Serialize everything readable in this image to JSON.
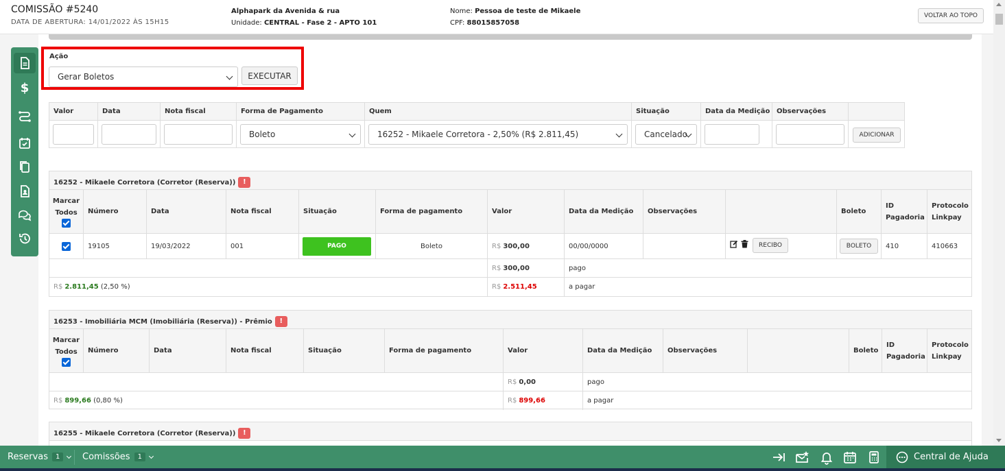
{
  "header": {
    "title": "COMISSÃO #5240",
    "opened": "DATA DE ABERTURA: 14/01/2022 ÀS 15H15",
    "project": "Alphapark da Avenida & rua",
    "unit_label": "Unidade:",
    "unit_value": "CENTRAL - Fase 2 - APTO 101",
    "name_label": "Nome:",
    "name_value": "Pessoa de teste de Mikaele",
    "cpf_label": "CPF:",
    "cpf_value": "88015857058",
    "back_to_top": "VOLTAR AO TOPO"
  },
  "sidebar": {
    "icons": [
      "document-icon",
      "dollar-icon",
      "route-icon",
      "calendar-check-icon",
      "copy-icon",
      "contact-icon",
      "chat-icon",
      "history-icon"
    ]
  },
  "action": {
    "label": "Ação",
    "selected": "Gerar Boletos",
    "execute": "EXECUTAR"
  },
  "form": {
    "headers": [
      "Valor",
      "Data",
      "Nota fiscal",
      "Forma de Pagamento",
      "Quem",
      "Situação",
      "Data da Medição",
      "Observações"
    ],
    "forma_selected": "Boleto",
    "quem_selected": "16252 - Mikaele Corretora - 2,50% (R$ 2.811,45)",
    "situacao_selected": "Cancelado",
    "add": "ADICIONAR"
  },
  "table_headers": {
    "marcar": "Marcar Todos",
    "numero": "Número",
    "data": "Data",
    "nota": "Nota fiscal",
    "situacao": "Situação",
    "forma": "Forma de pagamento",
    "valor": "Valor",
    "medicao": "Data da Medição",
    "obs": "Observações",
    "boleto": "Boleto",
    "id_pag": "ID Pagadoria",
    "protocolo": "Protocolo Linkpay"
  },
  "currency": "R$",
  "group1": {
    "title": "16252 - Mikaele Corretora (Corretor (Reserva))",
    "row": {
      "numero": "19105",
      "data": "19/03/2022",
      "nota": "001",
      "situacao": "PAGO",
      "forma": "Boleto",
      "valor": "300,00",
      "medicao": "00/00/0000",
      "recibo": "RECIBO",
      "boleto": "BOLETO",
      "id_pag": "410",
      "protocolo": "410663"
    },
    "pago_total": "300,00",
    "pago_label": "pago",
    "total_value": "2.811,45",
    "total_pct": "(2,50 %)",
    "a_pagar_value": "2.511,45",
    "a_pagar_label": "a pagar"
  },
  "group2": {
    "title": "16253 - Imobiliária MCM (Imobiliária (Reserva)) - Prêmio",
    "pago_total": "0,00",
    "pago_label": "pago",
    "total_value": "899,66",
    "total_pct": "(0,80 %)",
    "a_pagar_value": "899,66",
    "a_pagar_label": "a pagar"
  },
  "group3": {
    "title": "16255 - Mikaele Corretora (Corretor (Reserva))"
  },
  "warn_symbol": "!",
  "bottom": {
    "reservas": "Reservas",
    "reservas_count": "1",
    "comissoes": "Comissões",
    "comissoes_count": "1",
    "help": "Central de Ajuda"
  },
  "colors": {
    "brand_green": "#3f8f6a",
    "paid_green": "#3ec21f",
    "alert_red": "#e85d5d",
    "highlight_red": "#ee0000"
  }
}
